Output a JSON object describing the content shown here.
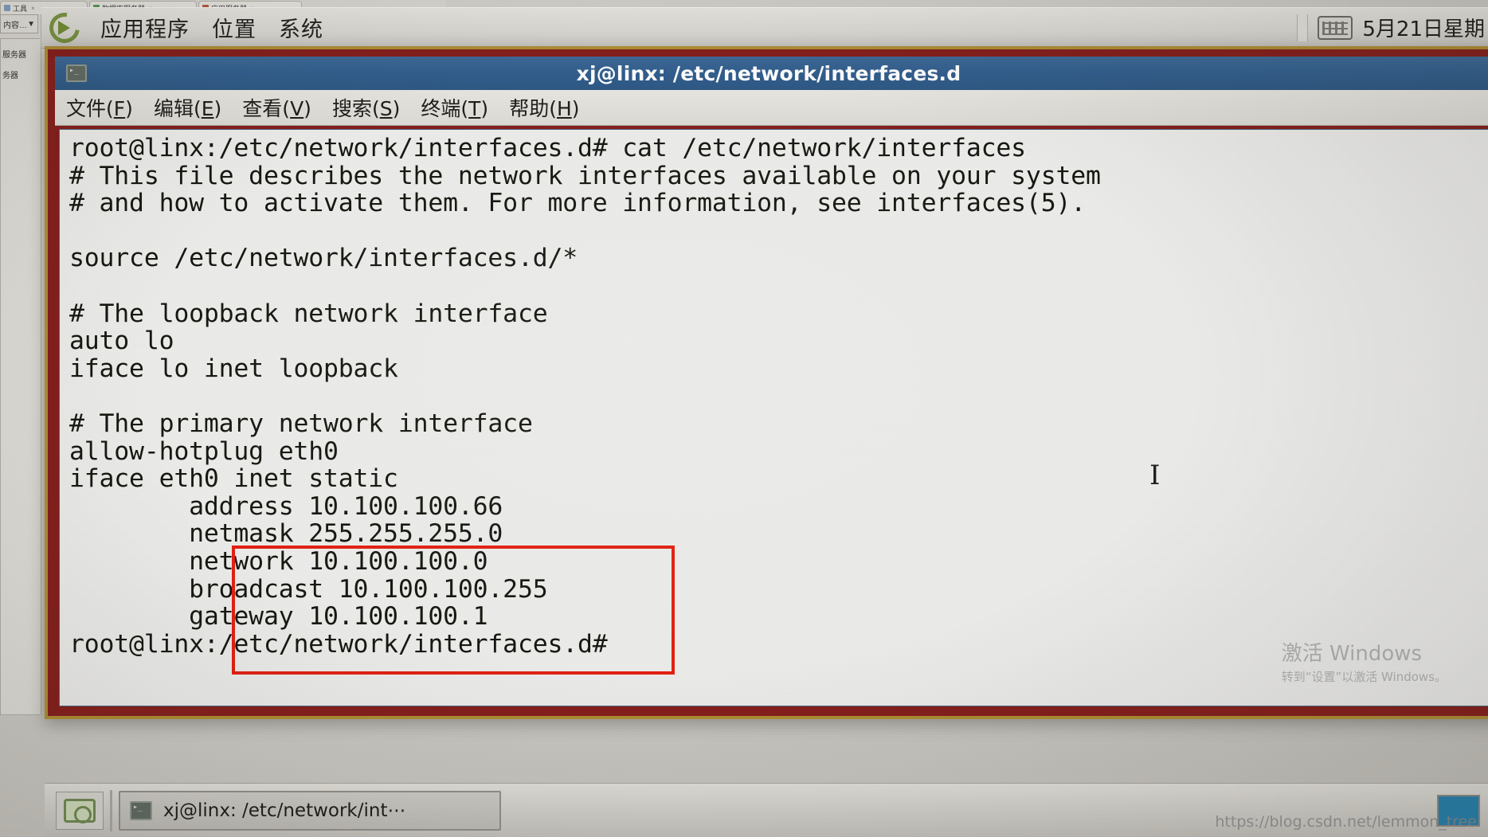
{
  "background": {
    "browser_tabs": [
      {
        "label": "工具",
        "close": "×"
      },
      {
        "label": "数据库服务器",
        "close": "×"
      },
      {
        "label": "应用服务器",
        "close": "×"
      }
    ],
    "left_panel": {
      "dropdown_label": "内容…",
      "dropdown_icon": "chevron-down-icon",
      "nodes": [
        "服务器",
        "务器"
      ]
    }
  },
  "gnome_panel": {
    "logo_icon": "gnome-foot-icon",
    "menus": [
      "应用程序",
      "位置",
      "系统"
    ],
    "keyboard_icon": "keyboard-icon",
    "clock": "5月21日星期"
  },
  "terminal": {
    "window_icon": "terminal-icon",
    "title": "xj@linx: /etc/network/interfaces.d",
    "menu": [
      {
        "label": "文件",
        "accel": "F"
      },
      {
        "label": "编辑",
        "accel": "E"
      },
      {
        "label": "查看",
        "accel": "V"
      },
      {
        "label": "搜索",
        "accel": "S"
      },
      {
        "label": "终端",
        "accel": "T"
      },
      {
        "label": "帮助",
        "accel": "H"
      }
    ],
    "content": "root@linx:/etc/network/interfaces.d# cat /etc/network/interfaces\n# This file describes the network interfaces available on your system\n# and how to activate them. For more information, see interfaces(5).\n\nsource /etc/network/interfaces.d/*\n\n# The loopback network interface\nauto lo\niface lo inet loopback\n\n# The primary network interface\nallow-hotplug eth0\niface eth0 inet static\n        address 10.100.100.66\n        netmask 255.255.255.0\n        network 10.100.100.0\n        broadcast 10.100.100.255\n        gateway 10.100.100.1\nroot@linx:/etc/network/interfaces.d#",
    "highlight_color": "#f01c0c",
    "highlighted_lines": [
      "address 10.100.100.66",
      "netmask 255.255.255.0",
      "network 10.100.100.0",
      "broadcast 10.100.100.255",
      "gateway 10.100.100.1"
    ],
    "cursor_glyph": "I",
    "title_bar_color": "#2e5f92",
    "frame_color": "#b08c2a",
    "background_color": "#ececea",
    "text_color": "#16160f"
  },
  "taskbar": {
    "show_desktop_icon": "show-desktop-icon",
    "task_icon": "terminal-icon",
    "task_label": "xj@linx: /etc/network/int⋯"
  },
  "watermarks": {
    "windows_line1": "激活 Windows",
    "windows_line2": "转到“设置”以激活 Windows。",
    "blog_url": "https://blog.csdn.net/lemmon_tree"
  }
}
